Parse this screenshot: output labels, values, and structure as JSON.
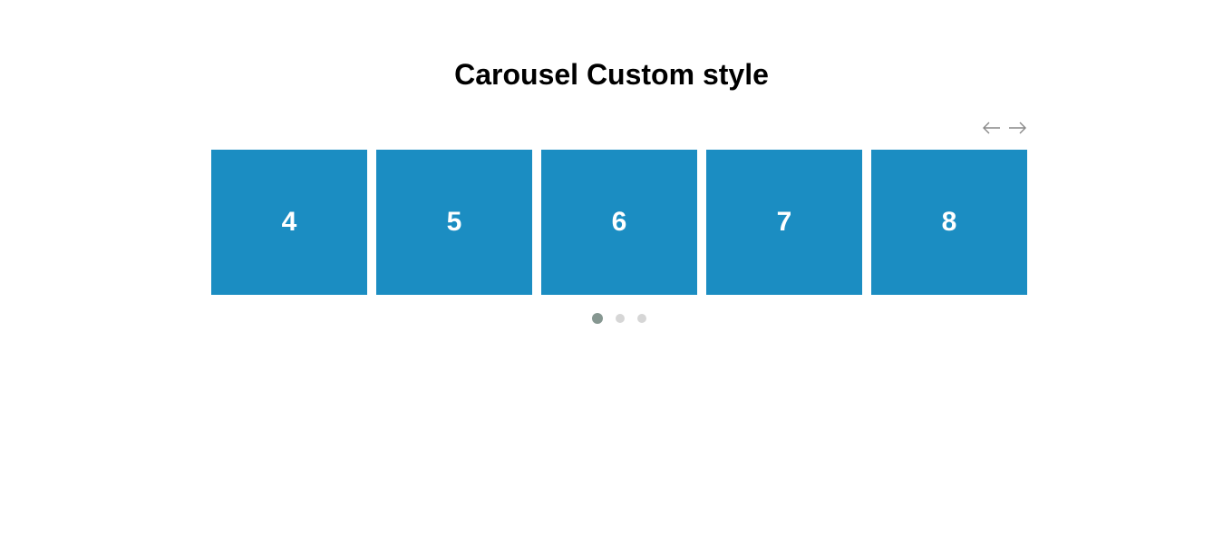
{
  "page": {
    "title": "Carousel Custom style"
  },
  "carousel": {
    "prev_icon": "arrow-left-icon",
    "next_icon": "arrow-right-icon",
    "slide_color": "#1b8dc2",
    "slide_text_color": "#ffffff",
    "arrow_color": "#888888",
    "slides": [
      {
        "label": "4"
      },
      {
        "label": "5"
      },
      {
        "label": "6"
      },
      {
        "label": "7"
      },
      {
        "label": "8"
      }
    ],
    "pagination": {
      "total": 3,
      "active_index": 0,
      "active_color": "#869791",
      "inactive_color": "#d6d6d6"
    }
  }
}
